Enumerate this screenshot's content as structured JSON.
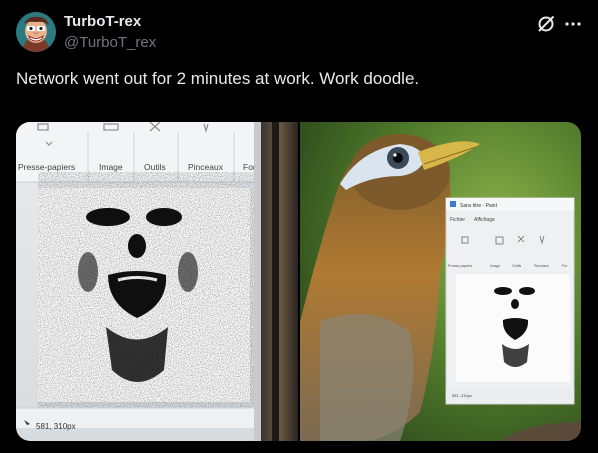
{
  "author": {
    "name": "TurboT-rex",
    "handle": "@TurboT_rex",
    "avatar_icon": "cartoon-face-avatar"
  },
  "tweet": {
    "text": "Network went out for 2 minutes at work. Work doodle."
  },
  "left_photo": {
    "toolbar": [
      "Presse-papiers",
      "Image",
      "Outils",
      "Pinceaux",
      "For"
    ],
    "status": "581, 310px"
  },
  "right_photo": {
    "window_title": "Sans titre - Paint",
    "menu": [
      "Fichier",
      "Affichage"
    ],
    "toolbar": [
      "Presse-papiers",
      "Image",
      "Outils",
      "Pinceaux",
      "For"
    ],
    "status": "581, 310px"
  },
  "colors": {
    "background": "#000000",
    "text_primary": "#e7e9ea",
    "text_secondary": "#71767b"
  }
}
